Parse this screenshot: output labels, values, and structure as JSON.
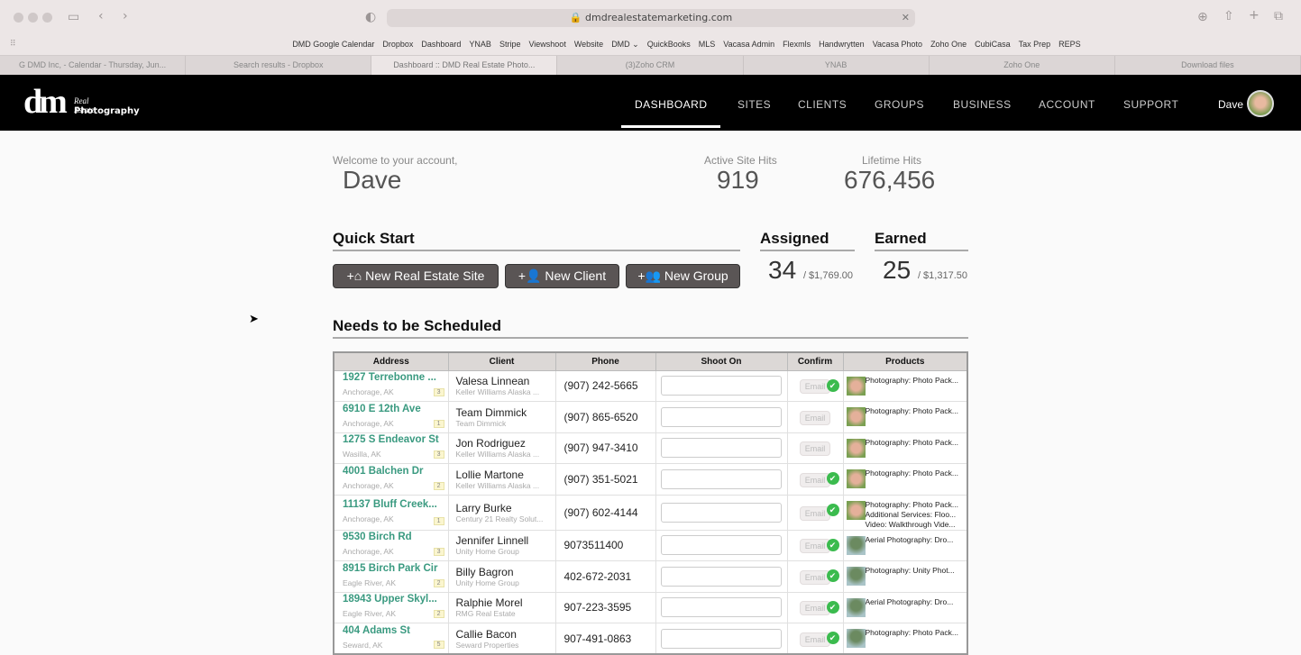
{
  "browser": {
    "url": "dmdrealestatemarketing.com",
    "bookmarks": [
      "DMD Google Calendar",
      "Dropbox",
      "Dashboard",
      "YNAB",
      "Stripe",
      "Viewshoot",
      "Website",
      "DMD ⌄",
      "QuickBooks",
      "MLS",
      "Vacasa Admin",
      "Flexmls",
      "Handwrytten",
      "Vacasa Photo",
      "Zoho One",
      "CubiCasa",
      "Tax Prep",
      "REPS"
    ],
    "tabs": [
      "G  DMD Inc, - Calendar - Thursday, Jun...",
      "Search results - Dropbox",
      "Dashboard :: DMD Real Estate Photo...",
      "(3)Zoho CRM",
      "YNAB",
      "Zoho One",
      "Download files"
    ]
  },
  "nav": {
    "logo": "dm Real Estate Photography",
    "items": [
      "DASHBOARD",
      "SITES",
      "CLIENTS",
      "GROUPS",
      "BUSINESS",
      "ACCOUNT",
      "SUPPORT"
    ],
    "active": "DASHBOARD",
    "user": "Dave"
  },
  "welcome": {
    "label": "Welcome to your account,",
    "name": "Dave"
  },
  "stats": {
    "active_label": "Active Site Hits",
    "active": "919",
    "lifetime_label": "Lifetime Hits",
    "lifetime": "676,456"
  },
  "quick_start": {
    "title": "Quick Start",
    "buttons": [
      "New Real Estate Site",
      "New Client",
      "New Group"
    ]
  },
  "assigned": {
    "title": "Assigned",
    "count": "34",
    "amount": "/ $1,769.00"
  },
  "earned": {
    "title": "Earned",
    "count": "25",
    "amount": "/ $1,317.50"
  },
  "schedule": {
    "title": "Needs to be Scheduled",
    "columns": [
      "Address",
      "Client",
      "Phone",
      "Shoot On",
      "Confirm",
      "Products"
    ],
    "email_label": "Email",
    "rows": [
      {
        "address": "1927 Terrebonne ...",
        "city": "Anchorage, AK",
        "badge": "3",
        "client": "Valesa Linnean",
        "office": "Keller Williams Alaska ...",
        "phone": "(907) 242-5665",
        "confirmed": true,
        "avatar": "a",
        "products": [
          "Photography: Photo Pack..."
        ]
      },
      {
        "address": "6910 E 12th Ave",
        "city": "Anchorage, AK",
        "badge": "1",
        "client": "Team Dimmick",
        "office": "Team Dimmick",
        "phone": "(907) 865-6520",
        "confirmed": false,
        "avatar": "a",
        "products": [
          "Photography: Photo Pack..."
        ]
      },
      {
        "address": "1275 S Endeavor St",
        "city": "Wasilla, AK",
        "badge": "3",
        "client": "Jon Rodriguez",
        "office": "Keller Williams Alaska ...",
        "phone": "(907) 947-3410",
        "confirmed": false,
        "avatar": "a",
        "products": [
          "Photography: Photo Pack..."
        ]
      },
      {
        "address": "4001 Balchen Dr",
        "city": "Anchorage, AK",
        "badge": "2",
        "client": "Lollie Martone",
        "office": "Keller Williams Alaska ...",
        "phone": "(907) 351-5021",
        "confirmed": true,
        "avatar": "a",
        "products": [
          "Photography: Photo Pack..."
        ]
      },
      {
        "address": "11137 Bluff Creek...",
        "city": "Anchorage, AK",
        "badge": "1",
        "client": "Larry Burke",
        "office": "Century 21 Realty Solut...",
        "phone": "(907) 602-4144",
        "confirmed": true,
        "avatar": "a",
        "products": [
          "Photography: Photo Pack...",
          "Additional Services: Floo...",
          "Video: Walkthrough Vide..."
        ]
      },
      {
        "address": "9530 Birch Rd",
        "city": "Anchorage, AK",
        "badge": "3",
        "client": "Jennifer Linnell",
        "office": "Unity Home Group",
        "phone": "9073511400",
        "confirmed": true,
        "avatar": "b",
        "products": [
          "Aerial Photography: Dro..."
        ]
      },
      {
        "address": "8915 Birch Park Cir",
        "city": "Eagle River, AK",
        "badge": "2",
        "client": "Billy Bagron",
        "office": "Unity Home Group",
        "phone": "402-672-2031",
        "confirmed": true,
        "avatar": "b",
        "products": [
          "Photography: Unity Phot..."
        ]
      },
      {
        "address": "18943 Upper Skyl...",
        "city": "Eagle River, AK",
        "badge": "2",
        "client": "Ralphie Morel",
        "office": "RMG Real Estate",
        "phone": "907-223-3595",
        "confirmed": true,
        "avatar": "b",
        "products": [
          "Aerial Photography: Dro..."
        ]
      },
      {
        "address": "404 Adams St",
        "city": "Seward, AK",
        "badge": "5",
        "client": "Callie Bacon",
        "office": "Seward Properties",
        "phone": "907-491-0863",
        "confirmed": true,
        "avatar": "b",
        "products": [
          "Photography: Photo Pack..."
        ]
      }
    ]
  }
}
